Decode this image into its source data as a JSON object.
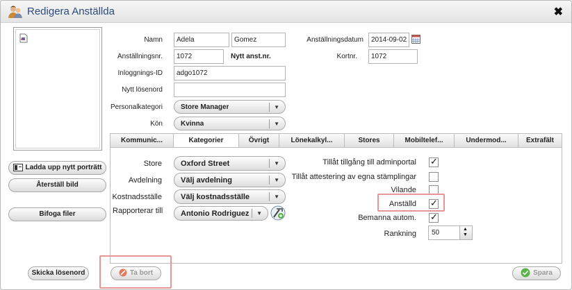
{
  "window": {
    "title": "Redigera Anställda",
    "close": "✖"
  },
  "photo": {
    "upload_label": "Ladda upp nytt porträtt",
    "reset_label": "Återställ bild",
    "attach_label": "Bifoga filer"
  },
  "form": {
    "name_label": "Namn",
    "first_name": "Adela",
    "last_name": "Gomez",
    "employment_date_label": "Anställningsdatum",
    "employment_date": "2014-09-02",
    "emp_no_label": "Anställningsnr.",
    "emp_no": "1072",
    "new_emp_no": "Nytt anst.nr.",
    "card_no_label": "Kortnr.",
    "card_no": "1072",
    "login_label": "Inloggnings-ID",
    "login": "adgo1072",
    "password_label": "Nytt lösenord",
    "password": "",
    "category_label": "Personalkategori",
    "category": "Store Manager",
    "gender_label": "Kön",
    "gender": "Kvinna"
  },
  "tabs": [
    {
      "label": "Kommunic..."
    },
    {
      "label": "Kategorier"
    },
    {
      "label": "Övrigt"
    },
    {
      "label": "Lönekalkyl..."
    },
    {
      "label": "Stores"
    },
    {
      "label": "Mobiltelef..."
    },
    {
      "label": "Undermod..."
    },
    {
      "label": "Extrafält"
    }
  ],
  "categories": {
    "store_label": "Store",
    "store": "Oxford Street",
    "department_label": "Avdelning",
    "department": "Välj avdelning",
    "cost_center_label": "Kostnadsställe",
    "cost_center": "Välj kostnadsställe",
    "reports_to_label": "Rapporterar till",
    "reports_to": "Antonio Rodriguez",
    "admin_access_label": "Tillåt tillgång till adminportal",
    "admin_access": true,
    "self_attest_label": "Tillåt attestering av egna stämplingar",
    "self_attest": false,
    "resting_label": "Vilande",
    "resting": false,
    "employed_label": "Anställd",
    "employed": true,
    "auto_staff_label": "Bemanna autom.",
    "auto_staff": true,
    "rank_label": "Rankning",
    "rank": "50"
  },
  "footer": {
    "send_password_label": "Skicka lösenord",
    "delete_label": "Ta bort",
    "save_label": "Spara"
  },
  "check_mark": "✓",
  "colors": {
    "title": "#2c4b7a",
    "highlight": "#e59696",
    "save_icon": "#5db34a",
    "delete_icon": "#e07a5f"
  }
}
